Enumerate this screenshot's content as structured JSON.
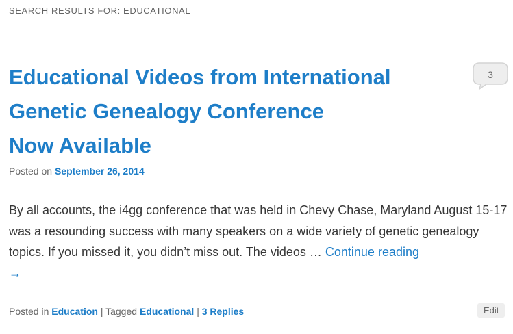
{
  "search": {
    "heading": "SEARCH RESULTS FOR: EDUCATIONAL"
  },
  "post": {
    "title_lines": [
      "Educational Videos from International",
      "Genetic Genealogy Conference",
      "Now Available"
    ],
    "comment_count": "3",
    "posted_on_label": "Posted on",
    "date": "September 26, 2014",
    "excerpt": "By all accounts, the i4gg conference that was held in Chevy Chase, Maryland August 15-17 was a resounding success with many speakers on a wide variety of genetic genealogy topics. If you missed it, you didn’t miss out.  The videos …",
    "continue_reading": "Continue reading",
    "continue_arrow": "→",
    "meta": {
      "posted_in_label": "Posted in",
      "category": "Education",
      "separator": "|",
      "tagged_label": "Tagged",
      "tag": "Educational",
      "replies": "3 Replies"
    },
    "edit_label": "Edit"
  },
  "colors": {
    "link": "#1e7ec8",
    "body_text": "#373737",
    "meta_text": "#666666",
    "edit_bg": "#eeeeee"
  },
  "icons": {
    "comment": "speech-bubble-icon"
  }
}
